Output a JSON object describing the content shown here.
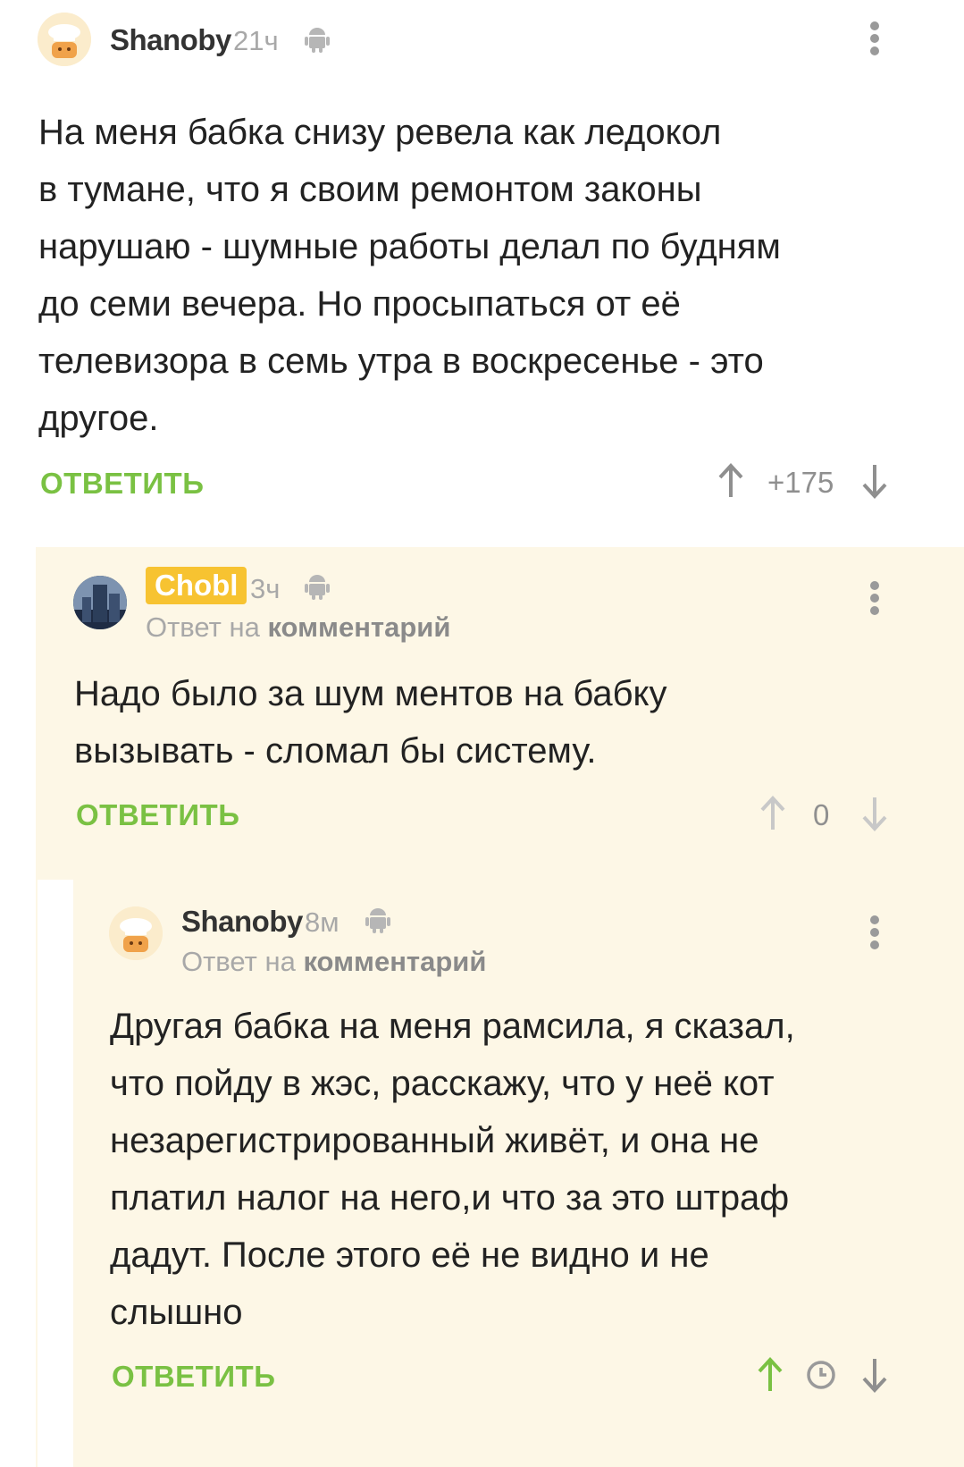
{
  "comments": [
    {
      "username": "Shanoby",
      "time": "21ч",
      "text_lines": [
        "На меня бабка снизу ревела как ледокол",
        "в тумане, что я своим ремонтом законы",
        "нарушаю - шумные работы делал по будням",
        "до семи вечера. Но просыпаться от её",
        "телевизора в семь утра в воскресенье - это",
        "другое."
      ],
      "reply_label": "ОТВЕТИТЬ",
      "rating": "+175"
    },
    {
      "username": "Chobl",
      "time": "3ч",
      "reply_to_prefix": "Ответ на",
      "reply_to_target": "комментарий",
      "text_lines": [
        "Надо было за шум ментов на бабку",
        "вызывать - сломал бы систему."
      ],
      "reply_label": "ОТВЕТИТЬ",
      "rating": "0"
    },
    {
      "username": "Shanoby",
      "time": "8м",
      "reply_to_prefix": "Ответ на",
      "reply_to_target": "комментарий",
      "text_lines": [
        "Другая бабка на меня рамсила, я сказал,",
        "что пойду в жэс, расскажу, что у неё кот",
        "незарегистрированный живёт, и она не",
        "платил налог на него,и что за это штраф",
        "дадут. После этого её не видно и не",
        "слышно"
      ],
      "reply_label": "ОТВЕТИТЬ"
    }
  ],
  "colors": {
    "accent_green": "#7ac143",
    "badge_yellow": "#f7c331",
    "panel_bg": "#fdf7e6"
  },
  "icons": [
    "chef-avatar-icon",
    "android-icon",
    "more-vertical-icon",
    "arrow-up-icon",
    "arrow-down-icon",
    "clock-icon"
  ]
}
